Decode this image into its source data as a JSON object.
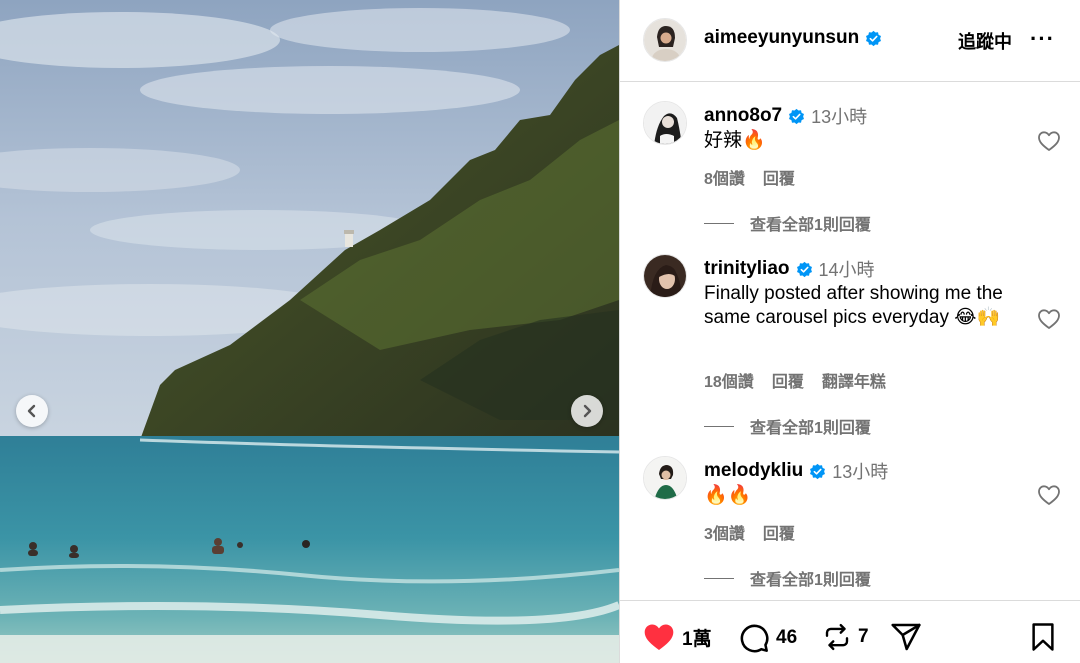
{
  "post": {
    "author": "aimeeyunyunsun",
    "follow_label": "追蹤中",
    "more_label": "···"
  },
  "comments": [
    {
      "user": "anno8o7",
      "time": "13小時",
      "text": "好辣🔥",
      "likes": "8個讚",
      "reply": "回覆",
      "translate": "",
      "view_replies": "查看全部1則回覆"
    },
    {
      "user": "trinityliao",
      "time": "14小時",
      "text": "Finally posted after showing me the same carousel pics everyday 😂🙌",
      "likes": "18個讚",
      "reply": "回覆",
      "translate": "翻譯年糕",
      "view_replies": "查看全部1則回覆"
    },
    {
      "user": "melodykliu",
      "time": "13小時",
      "text": "🔥🔥",
      "likes": "3個讚",
      "reply": "回覆",
      "translate": "",
      "view_replies": "查看全部1則回覆"
    }
  ],
  "actions": {
    "like_count": "1萬",
    "comment_count": "46",
    "repost_count": "7"
  },
  "icons": {
    "verified": "verified-badge-icon",
    "like": "heart-icon",
    "comment": "comment-bubble-icon",
    "repost": "repost-icon",
    "share": "send-icon",
    "save": "bookmark-icon",
    "prev": "chevron-left-icon",
    "next": "chevron-right-icon"
  },
  "colors": {
    "liked": "#ff3040",
    "verified": "#0095f6",
    "muted": "#737373",
    "divider": "#dbdbdb"
  }
}
